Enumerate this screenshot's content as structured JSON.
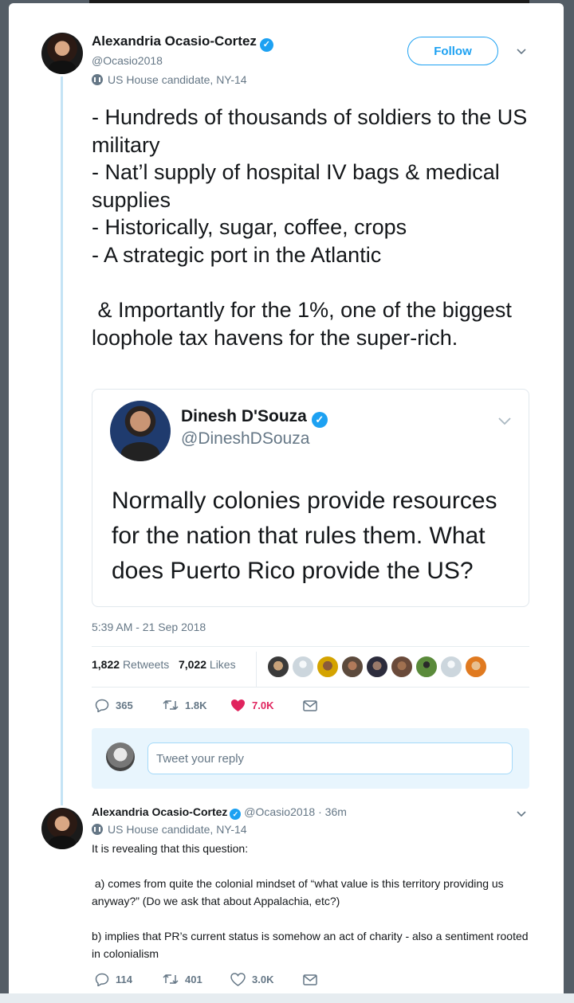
{
  "tweet": {
    "author_name": "Alexandria Ocasio-Cortez",
    "author_handle": "@Ocasio2018",
    "author_label": "US House candidate, NY-14",
    "follow_label": "Follow",
    "text": "- Hundreds of thousands of soldiers to the US military\n- Nat’l supply of hospital IV bags & medical supplies\n- Historically, sugar, coffee, crops\n- A strategic port in the Atlantic\n\n & Importantly for the 1%, one of the biggest loophole tax havens for the super-rich.",
    "quoted": {
      "author_name": "Dinesh D'Souza",
      "author_handle": "@DineshDSouza",
      "text": "Normally colonies provide resources for the nation that rules them. What does Puerto Rico provide the US?"
    },
    "timestamp": "5:39 AM - 21 Sep 2018",
    "retweets_count": "1,822",
    "retweets_label": "Retweets",
    "likes_count": "7,022",
    "likes_label": "Likes",
    "actions": {
      "replies": "365",
      "retweets": "1.8K",
      "likes": "7.0K"
    },
    "reply_placeholder": "Tweet your reply"
  },
  "reply_tweet": {
    "author_name": "Alexandria Ocasio-Cortez",
    "author_handle": "@Ocasio2018",
    "time_ago": "· 36m",
    "author_label": "US House candidate, NY-14",
    "paragraphs": [
      "It is revealing that this question:",
      " a) comes from quite the colonial mindset of “what value is this territory providing us anyway?” (Do we ask that about Appalachia, etc?)",
      "b) implies that PR’s current status is somehow an act of charity - also a sentiment rooted in colonialism"
    ],
    "actions": {
      "replies": "114",
      "retweets": "401",
      "likes": "3.0K"
    }
  },
  "colors": {
    "accent": "#1da1f2",
    "like_active": "#e0245e",
    "muted": "#657786",
    "thread_line": "#c4e3f5",
    "reply_box_bg": "#e8f5fd"
  },
  "icons": [
    "verified-icon",
    "building-icon",
    "chevron-down-icon",
    "reply-icon",
    "retweet-icon",
    "heart-icon",
    "envelope-icon"
  ]
}
